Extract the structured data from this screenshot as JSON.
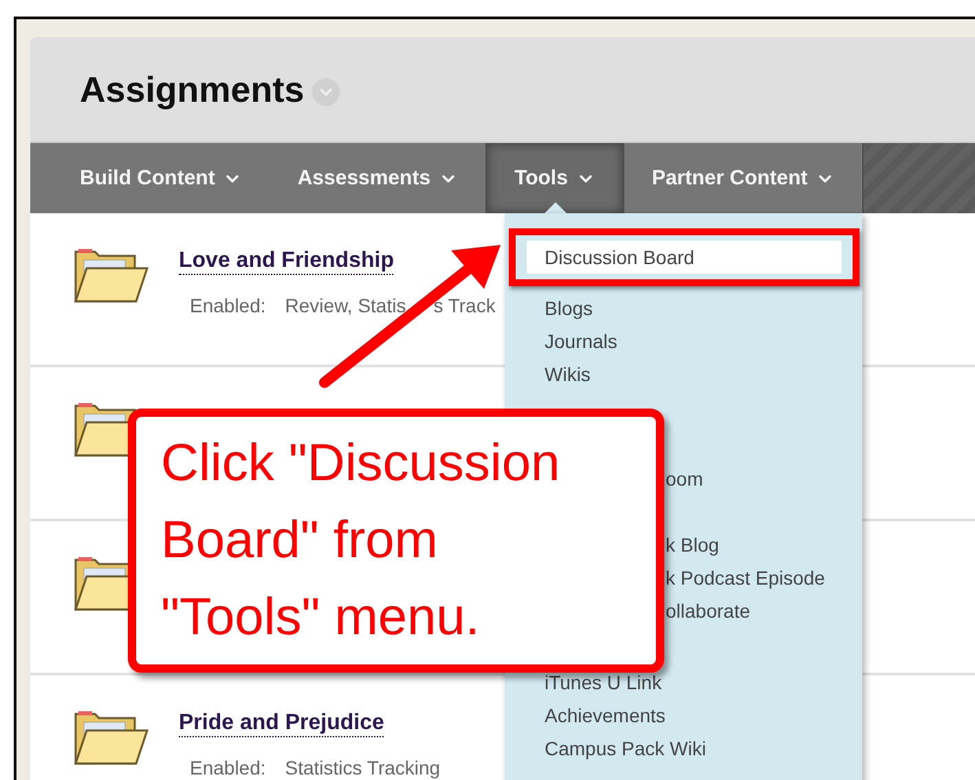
{
  "header": {
    "title": "Assignments"
  },
  "nav": [
    {
      "label": "Build Content",
      "selected": false
    },
    {
      "label": "Assessments",
      "selected": false
    },
    {
      "label": "Tools",
      "selected": true
    },
    {
      "label": "Partner Content",
      "selected": false
    }
  ],
  "rows": [
    {
      "kind": "item",
      "title": "Love and Friendship",
      "enabled_label": "Enabled:",
      "details": [
        "Review, Statis",
        "s Track"
      ]
    },
    {
      "kind": "covered"
    },
    {
      "kind": "covered"
    },
    {
      "kind": "item",
      "title": "Pride and Prejudice",
      "enabled_label": "Enabled:",
      "details": [
        "Statistics Tracking"
      ]
    }
  ],
  "menu": [
    {
      "kind": "item",
      "label": "Discussion Board",
      "selected": true
    },
    {
      "kind": "item",
      "label": "Blogs",
      "selected": false
    },
    {
      "kind": "item",
      "label": "Journals",
      "selected": false
    },
    {
      "kind": "item",
      "label": "Wikis",
      "selected": false
    },
    {
      "kind": "fragment",
      "label": "oom",
      "selected": false
    },
    {
      "kind": "fragment",
      "label": "k Blog",
      "selected": false
    },
    {
      "kind": "fragment",
      "label": "k Podcast Episode",
      "selected": false
    },
    {
      "kind": "fragment",
      "label": "ollaborate",
      "selected": false
    },
    {
      "kind": "item",
      "label": "iTunes U Link",
      "selected": false
    },
    {
      "kind": "item",
      "label": "Achievements",
      "selected": false
    },
    {
      "kind": "item",
      "label": "Campus Pack Wiki",
      "selected": false
    }
  ],
  "callout": {
    "text": "Click \"Discussion Board\" from \"Tools\" menu."
  }
}
